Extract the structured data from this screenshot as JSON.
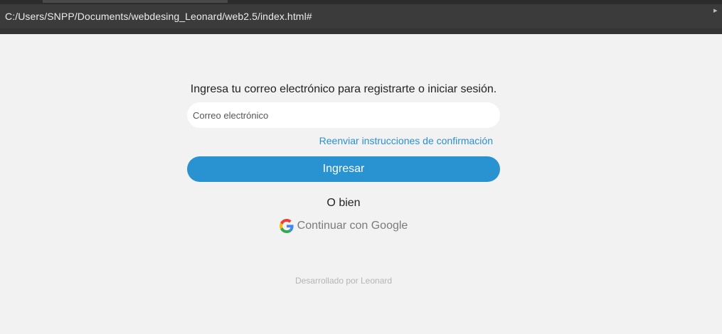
{
  "browser": {
    "address": "C:/Users/SNPP/Documents/webdesing_Leonard/web2.5/index.html#"
  },
  "login": {
    "instruction": "Ingresa tu correo electrónico para registrarte o iniciar sesión.",
    "email_placeholder": "Correo electrónico",
    "email_value": "",
    "resend_link": "Reenviar instrucciones de confirmación",
    "submit_label": "Ingresar",
    "or_text": "O bien",
    "google_label": "Continuar con Google"
  },
  "footer": {
    "credit": "Desarrollado por Leonard"
  },
  "colors": {
    "background": "#f2f2f2",
    "browser_bar": "#3b3b3b",
    "accent": "#2993d1",
    "link": "#2b8fd0",
    "muted_text": "#7a7a7a",
    "footer_text": "#b4b4b4"
  },
  "icons": {
    "google": "google-g-logo-icon",
    "bar_right": "chevron-icon"
  }
}
